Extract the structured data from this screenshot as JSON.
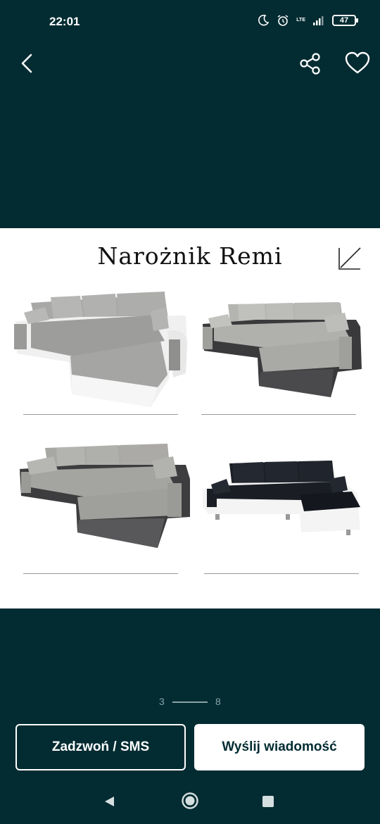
{
  "status_bar": {
    "time": "22:01",
    "network": "LTE",
    "battery": "47",
    "icons": [
      "moon-icon",
      "alarm-icon",
      "signal-icon",
      "battery-icon"
    ]
  },
  "nav": {
    "back_icon": "chevron-left-icon",
    "share_icon": "share-icon",
    "favorite_icon": "heart-icon"
  },
  "photo": {
    "title": "Narożnik Remi",
    "corner_icon": "corner-arrow-icon",
    "sofas": [
      {
        "name": "grey-fabric-white-base",
        "colors": {
          "fabric": "#a9a9a7",
          "base": "#f2f2f2"
        }
      },
      {
        "name": "grey-fabric-dark-base",
        "colors": {
          "fabric": "#b3b3b0",
          "base": "#3a3a3c"
        }
      },
      {
        "name": "grey-fabric-dark-base-angle",
        "colors": {
          "fabric": "#a7a7a4",
          "base": "#444446"
        }
      },
      {
        "name": "black-fabric-white-base",
        "colors": {
          "fabric": "#1c1f26",
          "base": "#f4f4f4"
        }
      }
    ]
  },
  "pager": {
    "current": "3",
    "total": "8"
  },
  "actions": {
    "call_label": "Zadzwoń / SMS",
    "message_label": "Wyślij wiadomość"
  },
  "colors": {
    "background": "#022c32",
    "white": "#ffffff"
  }
}
